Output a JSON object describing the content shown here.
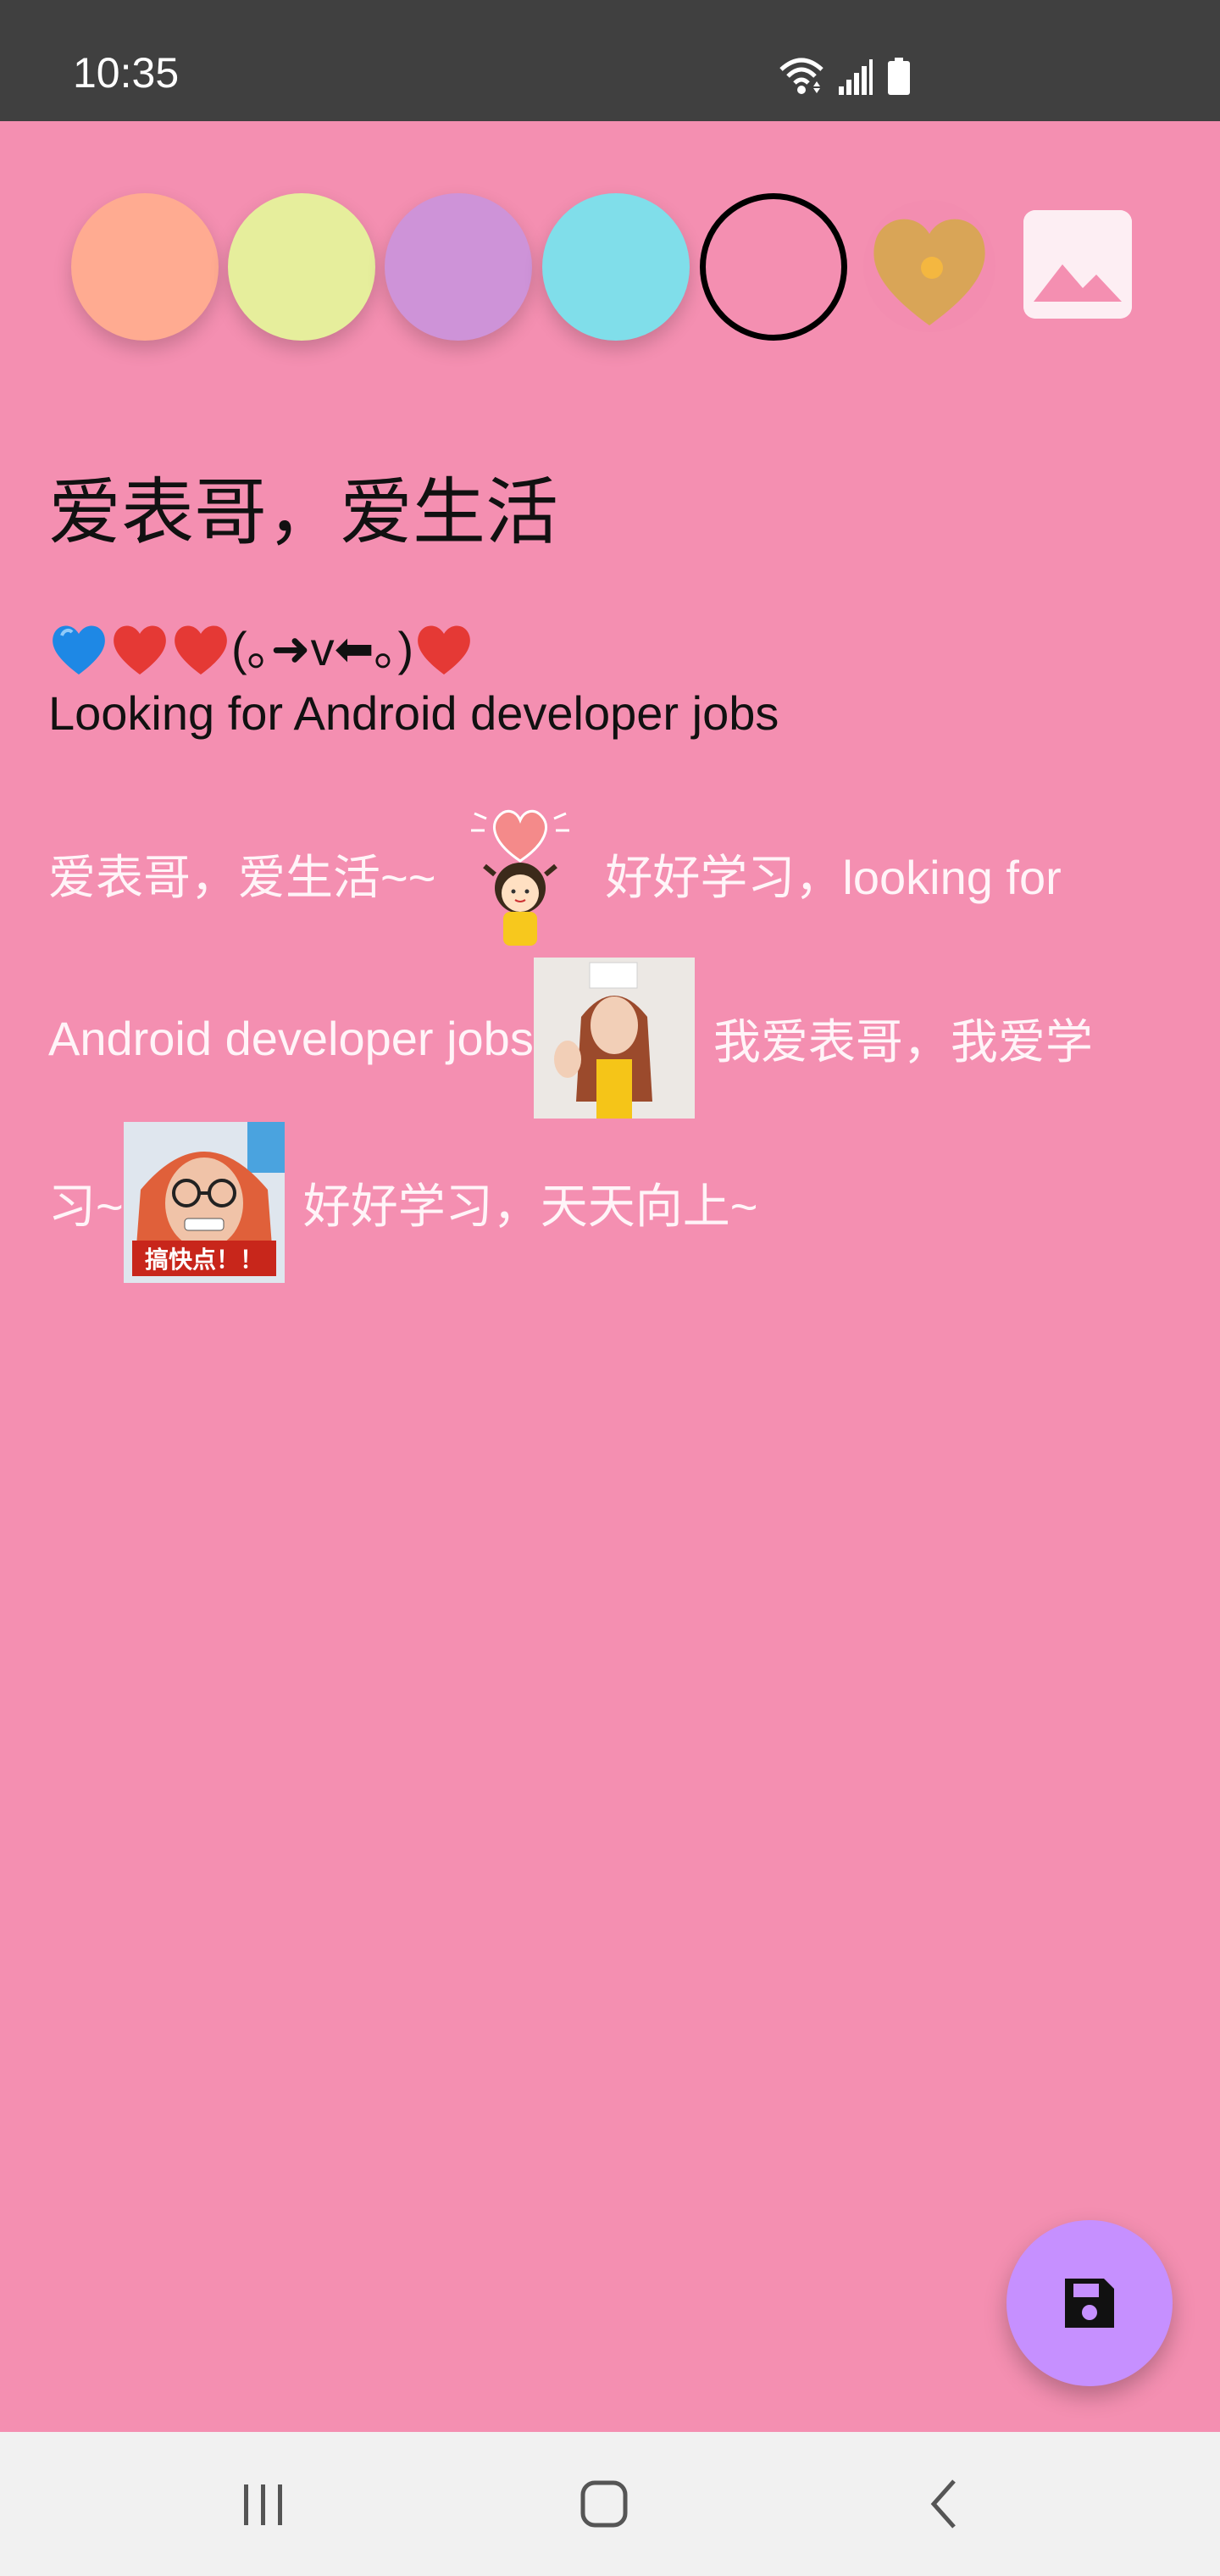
{
  "status_bar": {
    "time": "10:35",
    "icons": [
      "wifi-icon",
      "signal-icon",
      "battery-icon"
    ]
  },
  "color_picker": {
    "swatches": [
      {
        "name": "peach",
        "color": "#ffab91"
      },
      {
        "name": "lime",
        "color": "#e6ee9c"
      },
      {
        "name": "lavender",
        "color": "#ce93d8"
      },
      {
        "name": "cyan",
        "color": "#80deea"
      },
      {
        "name": "pink",
        "color": "#f48fb1",
        "selected": true
      }
    ],
    "heart_icon": "heart-icon",
    "image_icon": "image-icon",
    "heart_color": "#d9a557"
  },
  "note": {
    "title": "爱表哥，爱生活",
    "emoji_line_text": "(｡➜v⬅｡)",
    "line2": "Looking for Android developer jobs",
    "rich_line1_a": "爱表哥，爱生活~~",
    "rich_line1_b": "好好学习，looking for",
    "rich_line2_a": "Android developer jobs",
    "rich_line2_b": "我爱表哥，我爱学",
    "rich_line3_a": "习~",
    "rich_line3_b": "好好学习，天天向上~",
    "sticker3_caption": "搞快点！！"
  },
  "fab": {
    "icon": "save-icon",
    "color": "#c690ff"
  },
  "nav_bar": {
    "icons": [
      "recent-apps-icon",
      "home-icon",
      "back-icon"
    ]
  },
  "colors": {
    "background": "#f48fb1",
    "status_bar": "#404040",
    "nav_bar": "#f1f1f1"
  }
}
